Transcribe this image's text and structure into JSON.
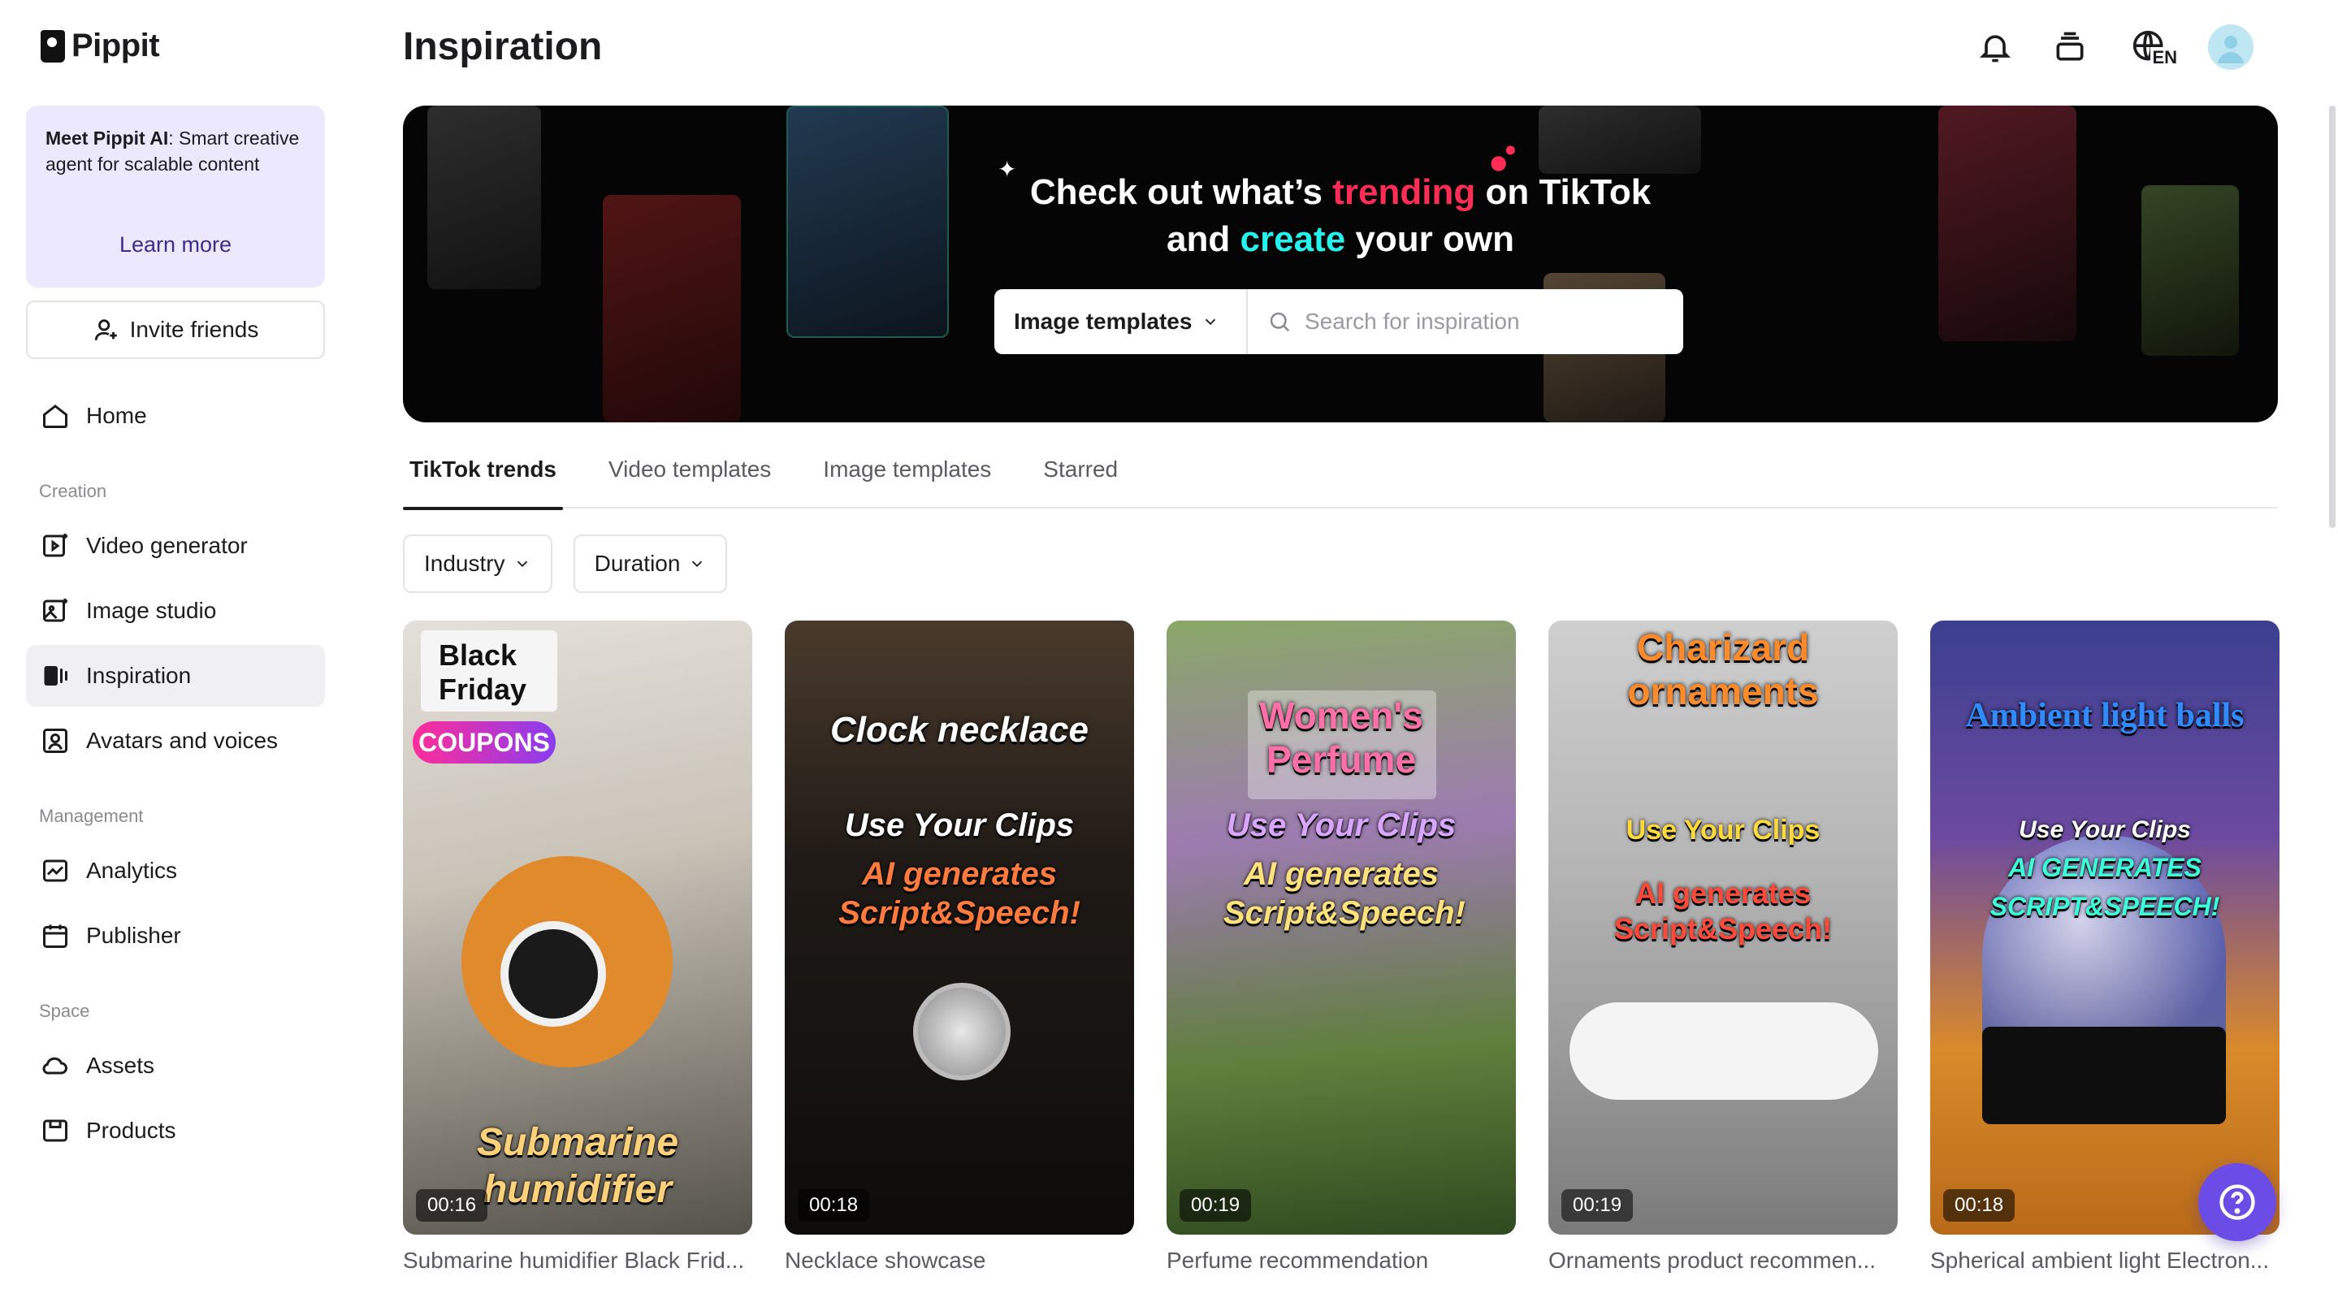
{
  "app": {
    "name": "Pippit"
  },
  "sidebar": {
    "promo": {
      "title": "Meet Pippit AI",
      "text": ": Smart creative agent for scalable content",
      "link": "Learn more"
    },
    "invite_label": "Invite friends",
    "home_label": "Home",
    "sections": {
      "creation": "Creation",
      "management": "Management",
      "space": "Space"
    },
    "items": {
      "video_generator": "Video generator",
      "image_studio": "Image studio",
      "inspiration": "Inspiration",
      "avatars_voices": "Avatars and voices",
      "analytics": "Analytics",
      "publisher": "Publisher",
      "assets": "Assets",
      "products": "Products"
    }
  },
  "header": {
    "title": "Inspiration",
    "language": "EN"
  },
  "banner": {
    "line1_a": "Check out what’s ",
    "line1_pink": "trending",
    "line1_b": " on TikTok",
    "line2_a": "and ",
    "line2_cyan": "create",
    "line2_b": " your own",
    "search_type": "Image templates",
    "search_placeholder": "Search for inspiration"
  },
  "tabs": [
    "TikTok trends",
    "Video templates",
    "Image templates",
    "Starred"
  ],
  "filters": [
    "Industry",
    "Duration"
  ],
  "cards": [
    {
      "caption": "Submarine humidifier Black Frid...",
      "duration": "00:16",
      "art_top": "Black Friday",
      "art_badge": "COUPONS",
      "art_bottom": "Submarine humidifier",
      "colors": [
        "#d8d4cc",
        "#e08a2c",
        "#2b2b2b"
      ]
    },
    {
      "caption": "Necklace showcase",
      "duration": "00:18",
      "art_top": "Clock necklace",
      "art_mid1": "Use Your Clips",
      "art_mid2": "AI generates Script&Speech!",
      "colors": [
        "#3a2e24",
        "#1a1a1a",
        "#0d0d0d"
      ]
    },
    {
      "caption": "Perfume recommendation",
      "duration": "00:19",
      "art_top": "Women's Perfume",
      "art_mid1": "Use Your Clips",
      "art_mid2": "AI generates Script&Speech!",
      "colors": [
        "#6f8f4a",
        "#b27cc4",
        "#3f5a2a"
      ]
    },
    {
      "caption": "Ornaments product recommen...",
      "duration": "00:19",
      "art_top": "Charizard ornaments",
      "art_mid1": "Use Your Clips",
      "art_mid2": "AI generates Script&Speech!",
      "colors": [
        "#bcbcbc",
        "#e9e9e9",
        "#8a8a8a"
      ]
    },
    {
      "caption": "Spherical ambient light Electron...",
      "duration": "00:18",
      "art_top": "Ambient light balls",
      "art_mid1": "Use Your Clips",
      "art_mid2": "AI GENERATES SCRIPT&SPEECH!",
      "colors": [
        "#3a3d8a",
        "#d97a1a",
        "#111"
      ]
    }
  ]
}
